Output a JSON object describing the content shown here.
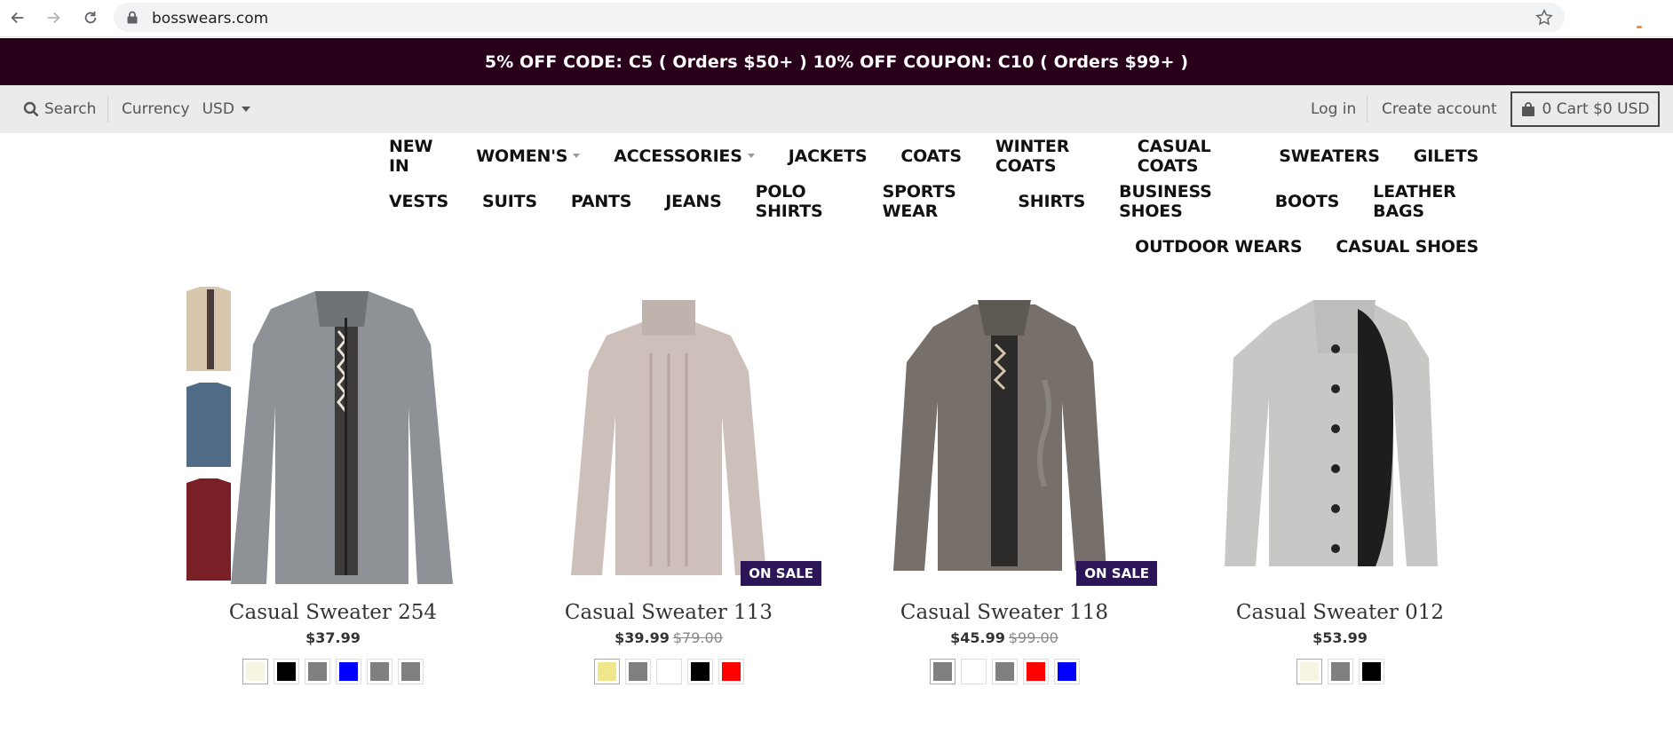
{
  "browser": {
    "url": "bosswears.com",
    "icons": [
      "back-arrow-icon",
      "forward-arrow-icon",
      "reload-icon",
      "lock-icon",
      "star-icon"
    ]
  },
  "announcement": "5% OFF CODE: C5 ( Orders $50+ ) 10% OFF COUPON: C10 ( Orders $99+ )",
  "utility": {
    "search_label": "Search",
    "currency_label": "Currency",
    "currency_value": "USD",
    "login_label": "Log in",
    "create_account_label": "Create account",
    "cart_label": "0 Cart $0 USD"
  },
  "nav": {
    "row1": [
      "NEW IN",
      "WOMEN'S",
      "ACCESSORIES",
      "JACKETS",
      "COATS",
      "WINTER COATS",
      "CASUAL COATS",
      "SWEATERS",
      "GILETS"
    ],
    "row2": [
      "VESTS",
      "SUITS",
      "PANTS",
      "JEANS",
      "POLO SHIRTS",
      "SPORTS WEAR",
      "SHIRTS",
      "BUSINESS SHOES",
      "BOOTS",
      "LEATHER BAGS"
    ],
    "row3": [
      "OUTDOOR WEARS",
      "CASUAL SHOES"
    ],
    "dropdowns": [
      "WOMEN'S",
      "ACCESSORIES"
    ]
  },
  "colors": {
    "announcement_bg": "#29001a",
    "sale_badge_bg": "#2c1657",
    "utility_bg": "#ebebeb"
  },
  "products": [
    {
      "title": "Casual Sweater 254",
      "price": "$37.99",
      "old_price": "",
      "badge": "",
      "swatches": [
        "#f5f5e1",
        "#000000",
        "#808080",
        "#0000ff",
        "#808080",
        "#808080"
      ]
    },
    {
      "title": "Casual Sweater 113",
      "price": "$39.99",
      "old_price": "$79.00",
      "badge": "ON SALE",
      "swatches": [
        "#f0e68c",
        "#808080",
        "#ffffff",
        "#000000",
        "#ff0000"
      ]
    },
    {
      "title": "Casual Sweater 118",
      "price": "$45.99",
      "old_price": "$99.00",
      "badge": "ON SALE",
      "swatches": [
        "#808080",
        "#ffffff",
        "#808080",
        "#ff0000",
        "#0000ff"
      ]
    },
    {
      "title": "Casual Sweater 012",
      "price": "$53.99",
      "old_price": "",
      "badge": "",
      "swatches": [
        "#f5f5e1",
        "#808080",
        "#000000"
      ]
    }
  ]
}
